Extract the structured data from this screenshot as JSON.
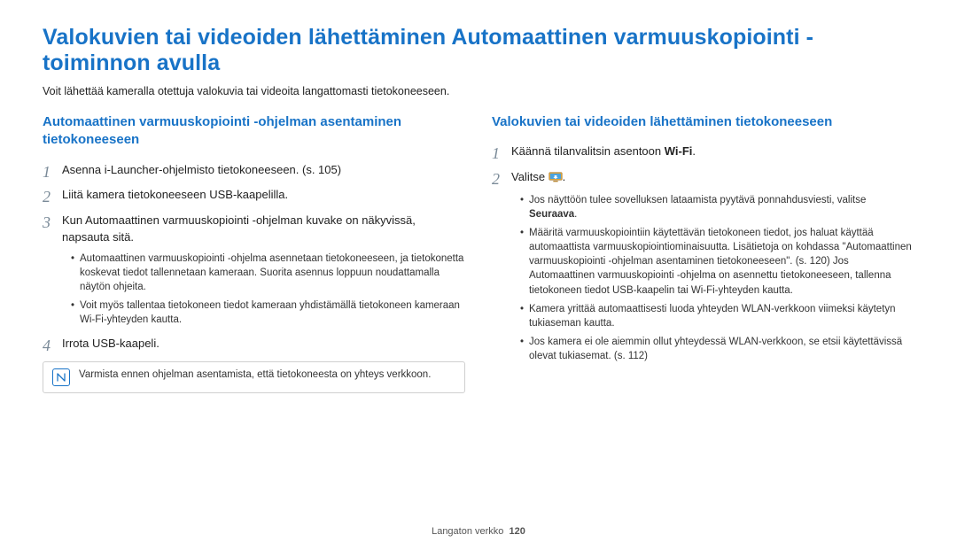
{
  "title": "Valokuvien tai videoiden lähettäminen Automaattinen varmuuskopiointi -toiminnon avulla",
  "intro": "Voit lähettää kameralla otettuja valokuvia tai videoita langattomasti tietokoneeseen.",
  "left": {
    "heading": "Automaattinen varmuuskopiointi -ohjelman asentaminen tietokoneeseen",
    "steps": [
      {
        "n": "1",
        "text": "Asenna i-Launcher-ohjelmisto tietokoneeseen. (s. 105)"
      },
      {
        "n": "2",
        "text": "Liitä kamera tietokoneeseen USB-kaapelilla."
      },
      {
        "n": "3",
        "text": "Kun Automaattinen varmuuskopiointi -ohjelman kuvake on näkyvissä, napsauta sitä.",
        "bullets": [
          "Automaattinen varmuuskopiointi -ohjelma asennetaan tietokoneeseen, ja tietokonetta koskevat tiedot tallennetaan kameraan. Suorita asennus loppuun noudattamalla näytön ohjeita.",
          "Voit myös tallentaa tietokoneen tiedot kameraan yhdistämällä tietokoneen kameraan Wi-Fi-yhteyden kautta."
        ]
      },
      {
        "n": "4",
        "text": "Irrota USB-kaapeli."
      }
    ],
    "note": "Varmista ennen ohjelman asentamista, että tietokoneesta on yhteys verkkoon."
  },
  "right": {
    "heading": "Valokuvien tai videoiden lähettäminen tietokoneeseen",
    "step1_pre": "Käännä tilanvalitsin asentoon ",
    "step1_wifi": "Wi-Fi",
    "step1_post": ".",
    "step2_pre": "Valitse ",
    "step2_post": ".",
    "bullets": [
      {
        "pre": "Jos näyttöön tulee sovelluksen lataamista pyytävä ponnahdusviesti, valitse ",
        "bold": "Seuraava",
        "post": "."
      },
      {
        "text": "Määritä varmuuskopiointiin käytettävän tietokoneen tiedot, jos haluat käyttää automaattista varmuuskopiointiominaisuutta. Lisätietoja on kohdassa \"Automaattinen varmuuskopiointi -ohjelman asentaminen tietokoneeseen\". (s. 120) Jos Automaattinen varmuuskopiointi -ohjelma on asennettu tietokoneeseen, tallenna tietokoneen tiedot USB-kaapelin tai Wi-Fi-yhteyden kautta."
      },
      {
        "text": "Kamera yrittää automaattisesti luoda yhteyden WLAN-verkkoon viimeksi käytetyn tukiaseman kautta."
      },
      {
        "text": "Jos kamera ei ole aiemmin ollut yhteydessä WLAN-verkkoon, se etsii käytettävissä olevat tukiasemat. (s. 112)"
      }
    ]
  },
  "footer": {
    "section": "Langaton verkko",
    "page": "120"
  }
}
